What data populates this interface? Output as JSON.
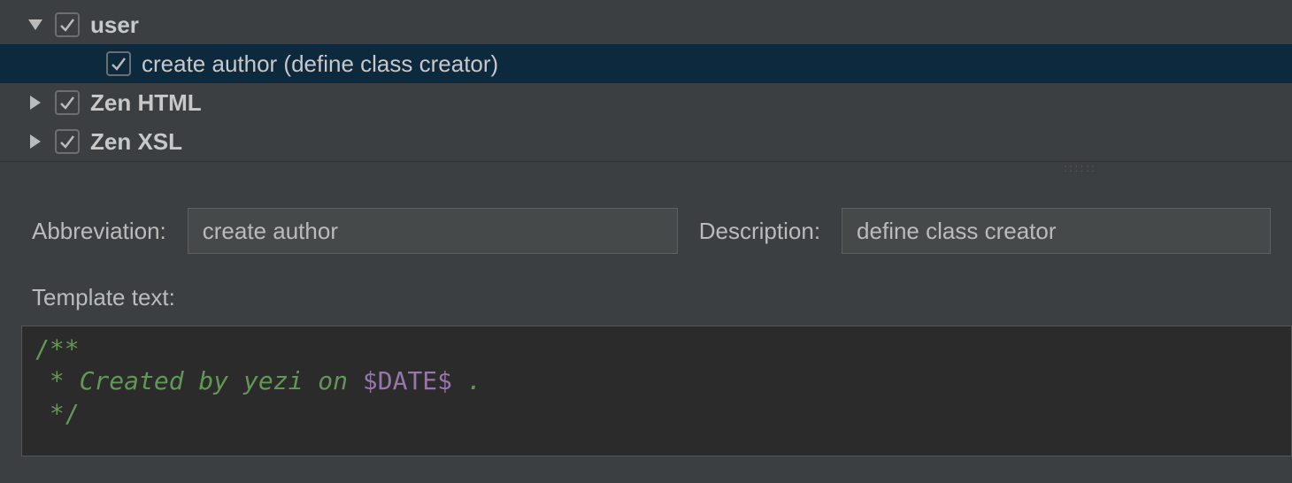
{
  "tree": {
    "items": [
      {
        "label": "user",
        "bold": true,
        "expanded": true,
        "checked": true,
        "hasDisclosure": true,
        "indent": 0,
        "selected": false
      },
      {
        "label": "create author (define class creator)",
        "bold": false,
        "expanded": false,
        "checked": true,
        "hasDisclosure": false,
        "indent": 1,
        "selected": true
      },
      {
        "label": "Zen HTML",
        "bold": true,
        "expanded": false,
        "checked": true,
        "hasDisclosure": true,
        "indent": 0,
        "selected": false
      },
      {
        "label": "Zen XSL",
        "bold": true,
        "expanded": false,
        "checked": true,
        "hasDisclosure": true,
        "indent": 0,
        "selected": false
      }
    ]
  },
  "form": {
    "abbreviation_label": "Abbreviation:",
    "abbreviation_value": "create author",
    "description_label": "Description:",
    "description_value": "define class creator",
    "template_label": "Template text:"
  },
  "template_code": {
    "line1": "/**",
    "line2_pre": " * Created by yezi on ",
    "line2_var": "$DATE$",
    "line2_post": " .",
    "line3": " */"
  }
}
